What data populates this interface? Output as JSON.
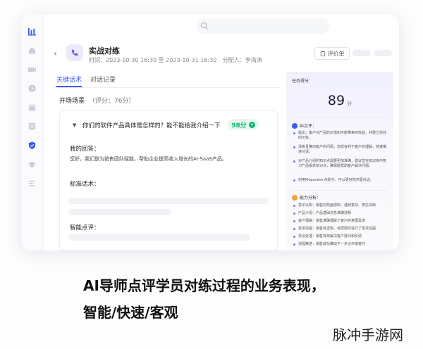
{
  "header": {
    "back_icon": "‹",
    "title": "实战对练",
    "time": "时间：2023-10-30 16:30 至 2023-10-31 16:30",
    "assignee": "分配人：李海涛",
    "eval_button": "评价单"
  },
  "tabs": [
    {
      "label": "关键话术",
      "active": true
    },
    {
      "label": "对话记录",
      "active": false
    }
  ],
  "scene": {
    "name": "开场场景",
    "score": "（评分：76分）"
  },
  "question": {
    "text": "你们的软件产品具体是怎样的？能不能给我介绍一下",
    "score": "98分"
  },
  "answer": {
    "title": "我的回答：",
    "text": "您好，我们是为销售团队赋能，帮助企业提高收入增长的AI-SaaS产品。"
  },
  "standard": {
    "title": "标准话术："
  },
  "review": {
    "title": "智能点评："
  },
  "panel": {
    "label": "任务得分：",
    "score": "89",
    "unit": "分",
    "ai_title": "AI点评：",
    "ai_items": [
      "提出，客户对产品的价值和可能带来的收益，并建立信任的印象。",
      "清晰且确切客户的问题，这样有利于客户的理解，快速推进对话。",
      "对产品介绍的知识点需要更加准确，建议您在知识库中复习产品相关知识点，确保能帮助客户解决问题。",
      "利用Megaview AI助手，可以更好地开展对话。"
    ],
    "ability_title": "能力分析：",
    "ability_items": [
      "意识认知：销售的局面感知、遇到复杂、表达清晰",
      "产品介绍：产品基础信息准确流畅",
      "客户理解：销售准确理解了客户的意图需求",
      "需求挖掘：销售有逻辑、有层层的进行了需求挖掘",
      "异议处理：销售有效解决客户疑问和反馈",
      "流程推进：销售成功推动下一步合作或者约"
    ]
  },
  "caption": {
    "line1": "AI导师点评学员对练过程的业务表现，",
    "line2": "智能/快速/客观"
  },
  "watermark": "脉冲手游网",
  "colors": {
    "accent": "#3a5cf0",
    "score_green": "#19b47a"
  }
}
